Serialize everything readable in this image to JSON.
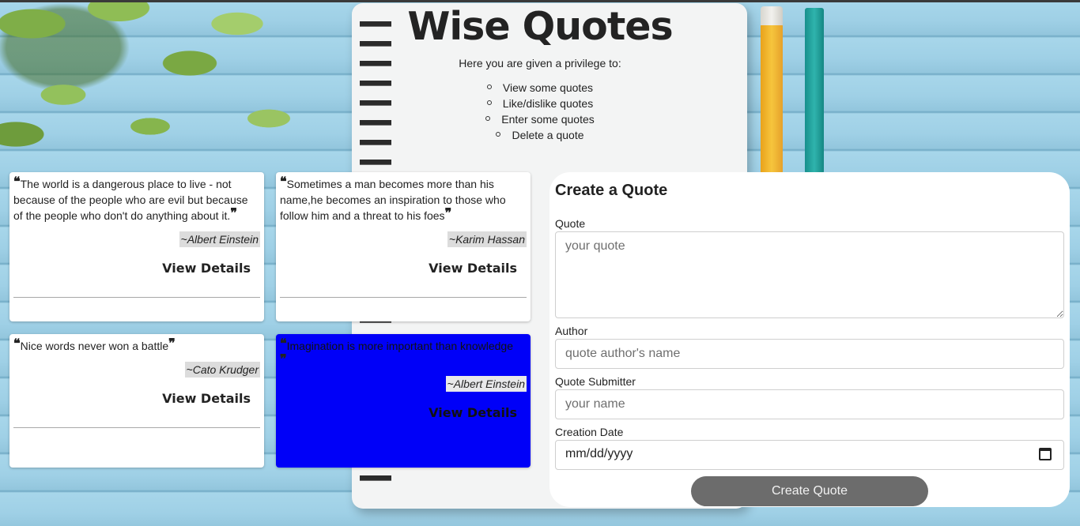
{
  "header": {
    "title": "Wise Quotes",
    "subtitle": "Here you are given a privilege to:",
    "privileges": [
      "View some quotes",
      "Like/dislike quotes",
      "Enter some quotes",
      "Delete a quote"
    ]
  },
  "quotes": [
    {
      "text": "The world is a dangerous place to live - not because of the people who are evil but because of the people who don't do anything about it.",
      "author": "~Albert Einstein",
      "details_label": "View Details",
      "highlighted": false
    },
    {
      "text": "Sometimes a man becomes more than his name,he becomes an inspiration to those who follow him and a threat to his foes",
      "author": "~Karim Hassan",
      "details_label": "View Details",
      "highlighted": false
    },
    {
      "text": "Nice words never won a battle",
      "author": "~Cato Krudger",
      "details_label": "View Details",
      "highlighted": false
    },
    {
      "text": "Imagination is more important than knowledge",
      "author": "~Albert Einstein",
      "details_label": "View Details",
      "highlighted": true
    }
  ],
  "form": {
    "title": "Create a Quote",
    "quote_label": "Quote",
    "quote_placeholder": "your quote",
    "author_label": "Author",
    "author_placeholder": "quote author's name",
    "submitter_label": "Quote Submitter",
    "submitter_placeholder": "your name",
    "date_label": "Creation Date",
    "date_placeholder": "mm/dd/yyyy",
    "submit_label": "Create Quote"
  },
  "colors": {
    "highlight_card": "#0000f8",
    "button": "#6c6c6c",
    "author_tag": "#dcdcdc"
  }
}
